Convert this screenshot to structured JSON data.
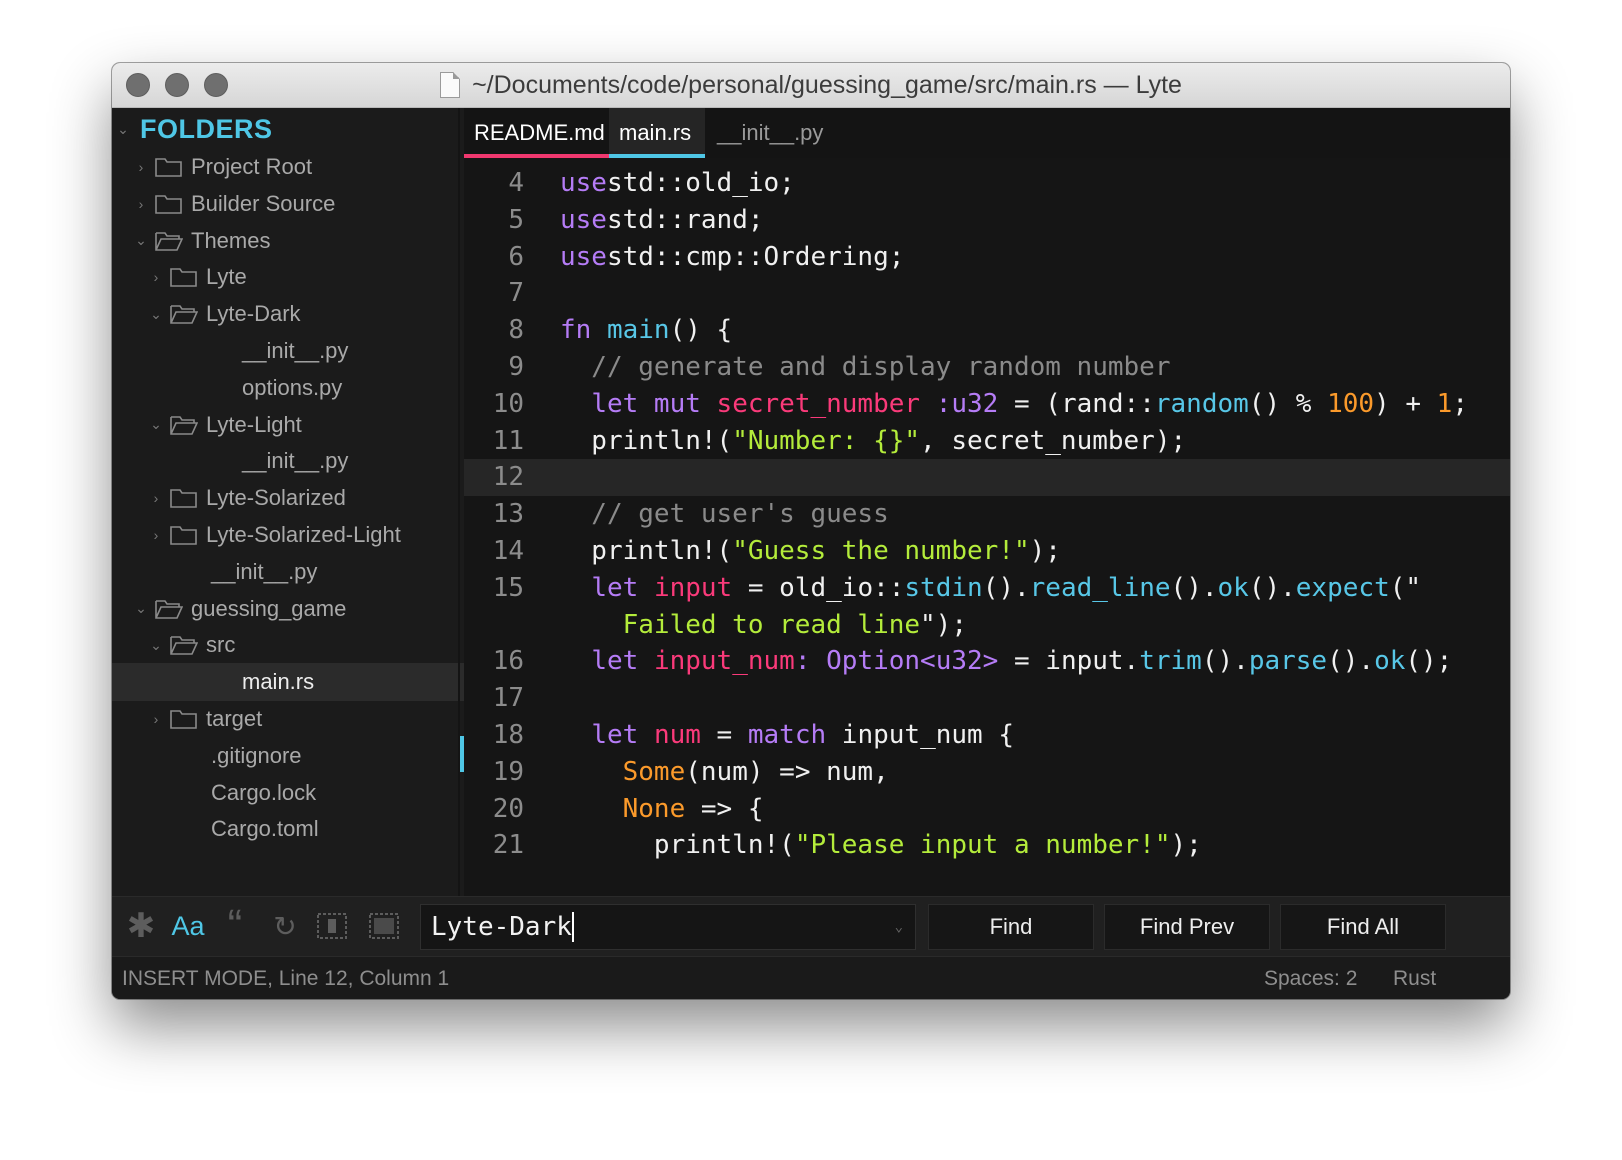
{
  "window": {
    "title": "~/Documents/code/personal/guessing_game/src/main.rs — Lyte"
  },
  "colors": {
    "accent": "#4fc7e6",
    "active_tab_line": "#f0386f",
    "keyword": "#b57cf6",
    "function": "#58c7e7",
    "variable": "#fa3a7a",
    "number": "#fb9a2b",
    "string": "#b4ec3b",
    "comment": "#8a8a8a"
  },
  "sidebar": {
    "header": "FOLDERS",
    "items": [
      {
        "label": "Project Root",
        "type": "folder",
        "state": "collapsed"
      },
      {
        "label": "Builder Source",
        "type": "folder",
        "state": "collapsed"
      },
      {
        "label": "Themes",
        "type": "folder",
        "state": "expanded"
      },
      {
        "label": "Lyte",
        "type": "folder",
        "state": "collapsed"
      },
      {
        "label": "Lyte-Dark",
        "type": "folder",
        "state": "expanded"
      },
      {
        "label": "__init__.py",
        "type": "file"
      },
      {
        "label": "options.py",
        "type": "file"
      },
      {
        "label": "Lyte-Light",
        "type": "folder",
        "state": "expanded"
      },
      {
        "label": "__init__.py",
        "type": "file"
      },
      {
        "label": "Lyte-Solarized",
        "type": "folder",
        "state": "collapsed"
      },
      {
        "label": "Lyte-Solarized-Light",
        "type": "folder",
        "state": "collapsed"
      },
      {
        "label": "__init__.py",
        "type": "file"
      },
      {
        "label": "guessing_game",
        "type": "folder",
        "state": "expanded"
      },
      {
        "label": "src",
        "type": "folder",
        "state": "expanded"
      },
      {
        "label": "main.rs",
        "type": "file",
        "selected": true
      },
      {
        "label": "target",
        "type": "folder",
        "state": "collapsed"
      },
      {
        "label": ".gitignore",
        "type": "file"
      },
      {
        "label": "Cargo.lock",
        "type": "file"
      },
      {
        "label": "Cargo.toml",
        "type": "file"
      }
    ]
  },
  "tabs": [
    {
      "label": "README.md",
      "state": "open"
    },
    {
      "label": "main.rs",
      "state": "active"
    },
    {
      "label": "__init__.py",
      "state": "inactive"
    }
  ],
  "editor": {
    "lines": [
      {
        "num": "4",
        "segments": [
          [
            "kw",
            "use"
          ],
          [
            "",
            "std::old_io;"
          ]
        ]
      },
      {
        "num": "5",
        "segments": [
          [
            "kw",
            "use"
          ],
          [
            "",
            "std::rand;"
          ]
        ]
      },
      {
        "num": "6",
        "segments": [
          [
            "kw",
            "use"
          ],
          [
            "",
            "std::cmp::Ordering;"
          ]
        ]
      },
      {
        "num": "7",
        "segments": []
      },
      {
        "num": "8",
        "segments": [
          [
            "kw",
            "fn"
          ],
          [
            "",
            " "
          ],
          [
            "fn",
            "main"
          ],
          [
            "",
            "() {"
          ]
        ]
      },
      {
        "num": "9",
        "segments": [
          [
            "cm",
            "  // generate and display random number"
          ]
        ]
      },
      {
        "num": "10",
        "segments": [
          [
            "",
            "  "
          ],
          [
            "kw",
            "let mut"
          ],
          [
            "",
            " "
          ],
          [
            "var",
            "secret_number"
          ],
          [
            "",
            " "
          ],
          [
            "kw",
            ":u32"
          ],
          [
            "",
            " = (rand::"
          ],
          [
            "fn",
            "random"
          ],
          [
            "",
            "() % "
          ],
          [
            "num",
            "100"
          ],
          [
            "",
            ") + "
          ],
          [
            "num",
            "1"
          ],
          [
            "",
            ";"
          ]
        ]
      },
      {
        "num": "11",
        "segments": [
          [
            "",
            "  println!("
          ],
          [
            "str",
            "\"Number: {}\""
          ],
          [
            "",
            ", secret_number);"
          ]
        ]
      },
      {
        "num": "12",
        "segments": [],
        "current": true
      },
      {
        "num": "13",
        "segments": [
          [
            "cm",
            "  // get user's guess"
          ]
        ]
      },
      {
        "num": "14",
        "segments": [
          [
            "",
            "  println!("
          ],
          [
            "str",
            "\"Guess the number!\""
          ],
          [
            "",
            ");"
          ]
        ]
      },
      {
        "num": "15",
        "segments": [
          [
            "",
            "  "
          ],
          [
            "kw",
            "let"
          ],
          [
            "",
            " "
          ],
          [
            "var",
            "input"
          ],
          [
            "",
            " = old_io::"
          ],
          [
            "fn",
            "stdin"
          ],
          [
            "",
            "()."
          ],
          [
            "fn",
            "read_line"
          ],
          [
            "",
            "()."
          ],
          [
            "fn",
            "ok"
          ],
          [
            "",
            "()."
          ],
          [
            "fn",
            "expect"
          ],
          [
            "",
            "(\""
          ]
        ]
      },
      {
        "num": "",
        "segments": [
          [
            "str",
            "    Failed to read line"
          ],
          [
            "",
            "\");"
          ]
        ]
      },
      {
        "num": "16",
        "segments": [
          [
            "",
            "  "
          ],
          [
            "kw",
            "let"
          ],
          [
            "",
            " "
          ],
          [
            "var",
            "input_num"
          ],
          [
            "kw",
            ": Option<u32>"
          ],
          [
            "",
            " = input."
          ],
          [
            "fn",
            "trim"
          ],
          [
            "",
            "()."
          ],
          [
            "fn",
            "parse"
          ],
          [
            "",
            "()."
          ],
          [
            "fn",
            "ok"
          ],
          [
            "",
            "();"
          ]
        ]
      },
      {
        "num": "17",
        "segments": []
      },
      {
        "num": "18",
        "segments": [
          [
            "",
            "  "
          ],
          [
            "kw",
            "let"
          ],
          [
            "",
            " "
          ],
          [
            "var",
            "num"
          ],
          [
            "",
            " = "
          ],
          [
            "kw",
            "match"
          ],
          [
            "",
            " input_num {"
          ]
        ]
      },
      {
        "num": "19",
        "segments": [
          [
            "",
            "    "
          ],
          [
            "num",
            "Some"
          ],
          [
            "",
            "(num) => num,"
          ]
        ]
      },
      {
        "num": "20",
        "segments": [
          [
            "",
            "    "
          ],
          [
            "num",
            "None"
          ],
          [
            "",
            " => {"
          ]
        ]
      },
      {
        "num": "21",
        "segments": [
          [
            "",
            "      println!("
          ],
          [
            "str",
            "\"Please input a number!\""
          ],
          [
            "",
            ");"
          ]
        ]
      }
    ]
  },
  "findbar": {
    "icons": [
      "regex-icon",
      "case-sensitive-icon",
      "whole-word-icon",
      "wrap-icon",
      "in-selection-icon",
      "highlight-matches-icon"
    ],
    "case_label": "Aa",
    "quote_label": "“",
    "query": "Lyte-Dark",
    "find_label": "Find",
    "find_prev_label": "Find Prev",
    "find_all_label": "Find All"
  },
  "statusbar": {
    "left": "INSERT MODE, Line 12, Column 1",
    "spaces": "Spaces: 2",
    "syntax": "Rust"
  }
}
